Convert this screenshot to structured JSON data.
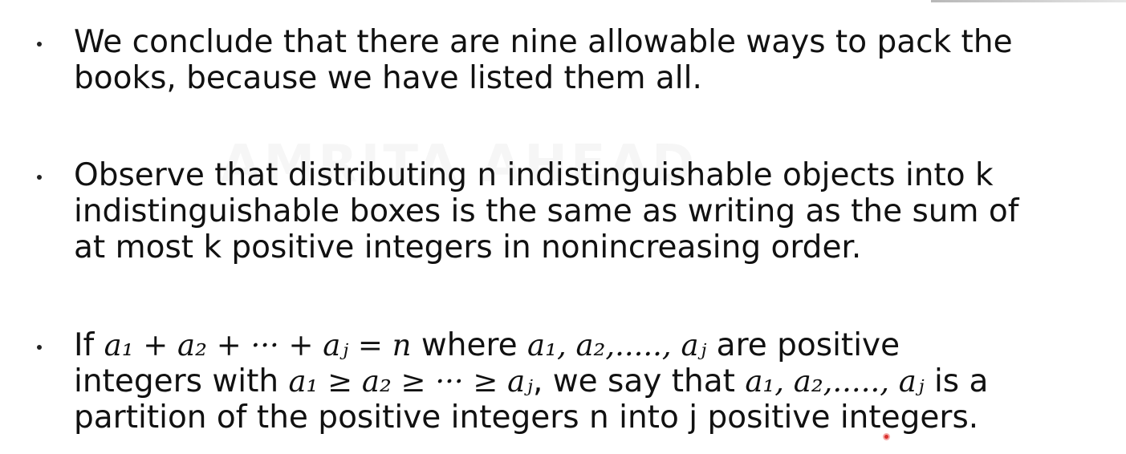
{
  "watermark": "AMRITA AHEAD",
  "bullets": [
    {
      "lines": [
        "We conclude that there are nine allowable ways to pack the",
        "books, because we have listed them all."
      ]
    },
    {
      "lines": [
        "Observe that distributing n indistinguishable objects into k",
        "indistinguishable boxes is the same as writing as the sum of",
        "at most k positive integers in nonincreasing order."
      ]
    },
    {
      "line1": {
        "prefix": "If ",
        "equation": "a₁ + a₂ + ··· + aⱼ = n",
        "middle": " where ",
        "terms": "a₁, a₂,....., aⱼ",
        "suffix": " are positive"
      },
      "line2": {
        "prefix": "integers with ",
        "inequality": "a₁ ≥ a₂ ≥ ··· ≥ aⱼ",
        "middle": ", we say that ",
        "terms": "a₁, a₂,....., aⱼ",
        "suffix": " is a"
      },
      "line3": "partition of the positive integers n into j positive integers."
    }
  ]
}
